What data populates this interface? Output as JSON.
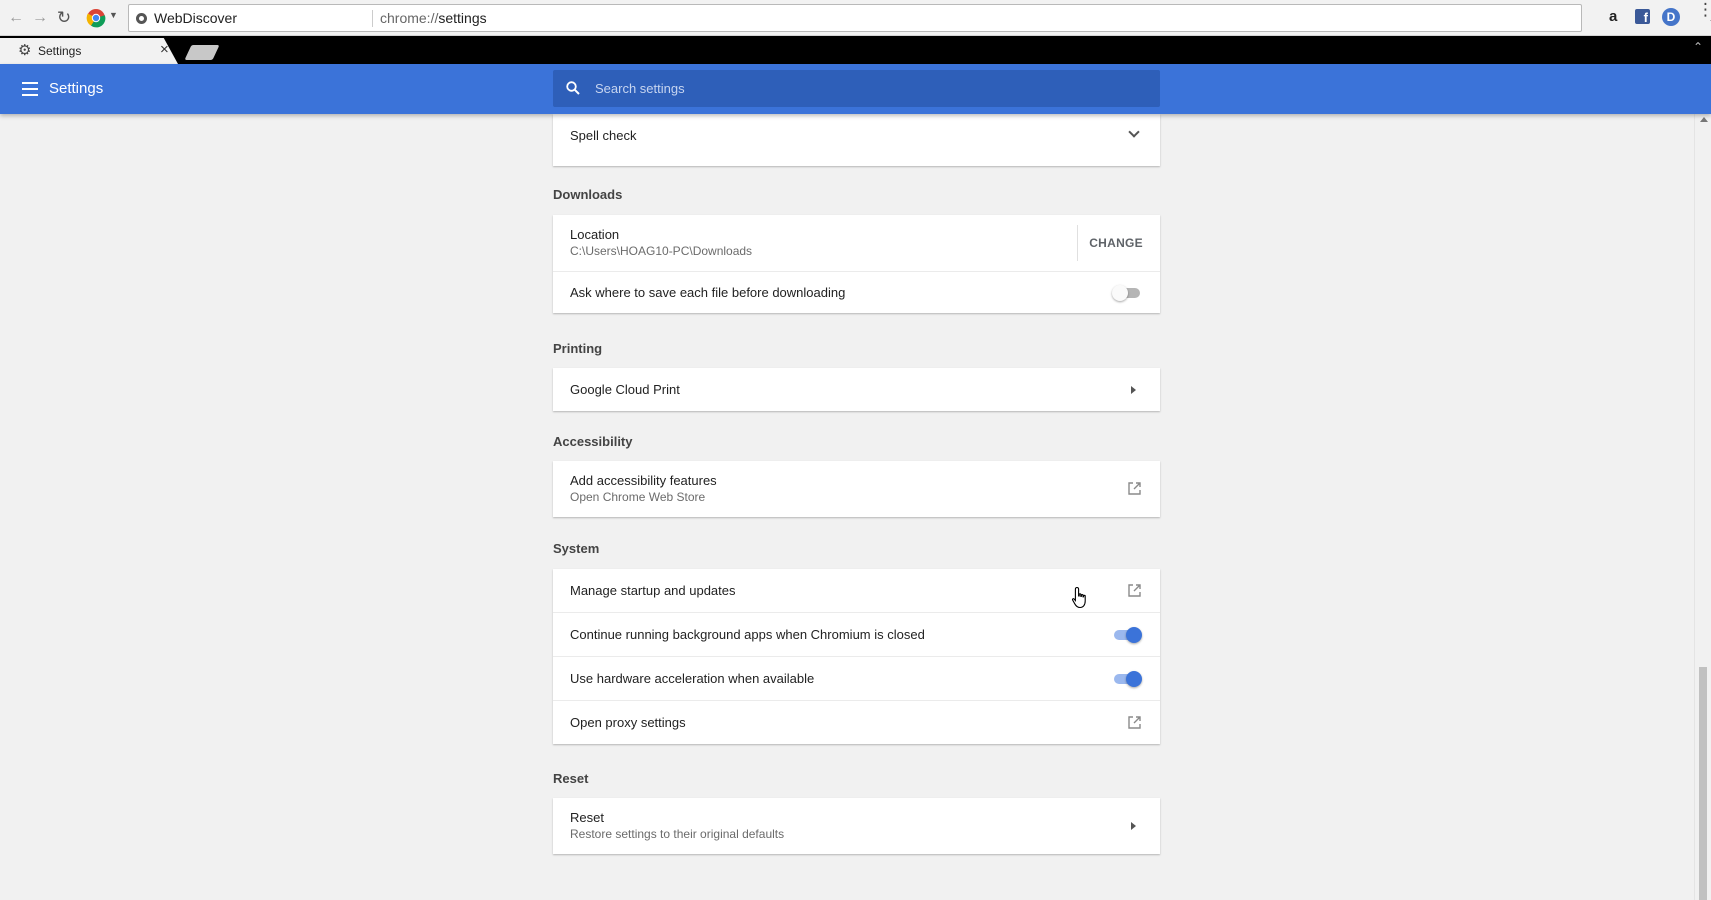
{
  "browser": {
    "site_name": "WebDiscover",
    "url_scheme": "chrome://",
    "url_path": "settings",
    "tab_title": "Settings"
  },
  "header": {
    "title": "Settings",
    "search_placeholder": "Search settings"
  },
  "spellcheck": {
    "label": "Spell check"
  },
  "downloads": {
    "title": "Downloads",
    "location_label": "Location",
    "location_value": "C:\\Users\\HOAG10-PC\\Downloads",
    "change_label": "CHANGE",
    "ask_label": "Ask where to save each file before downloading",
    "ask_enabled": false
  },
  "printing": {
    "title": "Printing",
    "cloud_print_label": "Google Cloud Print"
  },
  "accessibility": {
    "title": "Accessibility",
    "add_label": "Add accessibility features",
    "add_sub": "Open Chrome Web Store"
  },
  "system": {
    "title": "System",
    "startup_label": "Manage startup and updates",
    "background_label": "Continue running background apps when Chromium is closed",
    "background_enabled": true,
    "hw_accel_label": "Use hardware acceleration when available",
    "hw_accel_enabled": true,
    "proxy_label": "Open proxy settings"
  },
  "reset": {
    "title": "Reset",
    "label": "Reset",
    "sub": "Restore settings to their original defaults"
  },
  "colors": {
    "accent": "#3b73d9",
    "search_bg": "#2e5fb9",
    "page_bg": "#f1f1f1"
  }
}
